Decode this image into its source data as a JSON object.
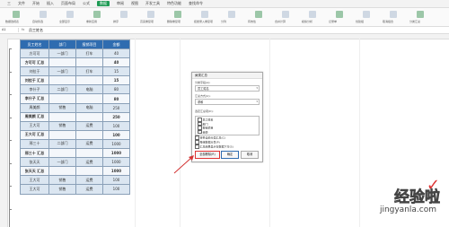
{
  "menu": {
    "items": [
      "三",
      "文件",
      "开始",
      "插入",
      "页面布局",
      "公式",
      "数据",
      "审阅",
      "视图",
      "开发工具",
      "特色功能",
      "查找命令"
    ],
    "active_index": 6
  },
  "ribbon": {
    "labels": [
      "数据透视表",
      "自动筛选",
      "全部显示",
      "重新应用",
      "排序",
      "高亮重复项",
      "删除重复项",
      "拒绝录入重复项",
      "分列",
      "有效性",
      "合并计算",
      "模拟分析",
      "记录单",
      "创建组",
      "取消组合",
      "分类汇总"
    ]
  },
  "formula_bar": {
    "name_box": "A1",
    "fx_label": "fx",
    "value": "员工姓名"
  },
  "table": {
    "header": [
      "员工姓名",
      "部门",
      "报销项目",
      "金额"
    ],
    "rows": [
      {
        "type": "data",
        "cells": [
          "方可可",
          "一部门",
          "打车",
          "40"
        ]
      },
      {
        "type": "sum",
        "cells": [
          "方可可 汇总",
          "",
          "",
          "40"
        ]
      },
      {
        "type": "data",
        "cells": [
          "刘拉于",
          "一部门",
          "打车",
          "15"
        ]
      },
      {
        "type": "sum",
        "cells": [
          "刘拉于 汇总",
          "",
          "",
          "15"
        ]
      },
      {
        "type": "data",
        "cells": [
          "李什子",
          "二部门",
          "电脑",
          "80"
        ]
      },
      {
        "type": "sum",
        "cells": [
          "李什子 汇总",
          "",
          "",
          "80"
        ]
      },
      {
        "type": "data",
        "cells": [
          "周美颜",
          "销售",
          "电脑",
          "250"
        ]
      },
      {
        "type": "sum",
        "cells": [
          "周美颜 汇总",
          "",
          "",
          "250"
        ]
      },
      {
        "type": "data",
        "cells": [
          "王大可",
          "销售",
          "运费",
          "100"
        ]
      },
      {
        "type": "sum",
        "cells": [
          "王大可 汇总",
          "",
          "",
          "100"
        ]
      },
      {
        "type": "data",
        "cells": [
          "邢三十",
          "二部门",
          "运费",
          "1000"
        ]
      },
      {
        "type": "sum",
        "cells": [
          "邢三十 汇总",
          "",
          "",
          "1000"
        ]
      },
      {
        "type": "data",
        "cells": [
          "张天天",
          "一部门",
          "运费",
          "1000"
        ]
      },
      {
        "type": "sum",
        "cells": [
          "张天天 汇总",
          "",
          "",
          "1000"
        ]
      },
      {
        "type": "data",
        "cells": [
          "王大可",
          "销售",
          "运费",
          "100"
        ]
      },
      {
        "type": "data",
        "cells": [
          "王大可",
          "销售",
          "运费",
          "100"
        ]
      }
    ]
  },
  "dialog": {
    "title": "分类汇总",
    "close": "×",
    "group_label": "分类字段(A):",
    "group_value": "员工姓名",
    "method_label": "汇总方式(U):",
    "method_value": "求和",
    "items_label": "选定汇总项(D):",
    "items": [
      {
        "label": "员工姓名",
        "checked": false
      },
      {
        "label": "部门",
        "checked": false
      },
      {
        "label": "报销项目",
        "checked": false
      },
      {
        "label": "金额",
        "checked": true
      }
    ],
    "options": [
      {
        "label": "替换当前分类汇总(C)",
        "checked": true
      },
      {
        "label": "每组数据分页(P)",
        "checked": false
      },
      {
        "label": "汇总结果显示在数据下方(S)",
        "checked": true
      }
    ],
    "buttons": [
      "全部删除(R)",
      "确定",
      "取消"
    ]
  },
  "watermark": {
    "line1": "经验啦",
    "line2": "jingyanla.com",
    "check": "✓"
  },
  "colors": {
    "accent_green": "#1f9b55",
    "header_blue": "#2f6cb0",
    "cell_blue": "#dbe6f1",
    "highlight_red": "#d33333"
  }
}
